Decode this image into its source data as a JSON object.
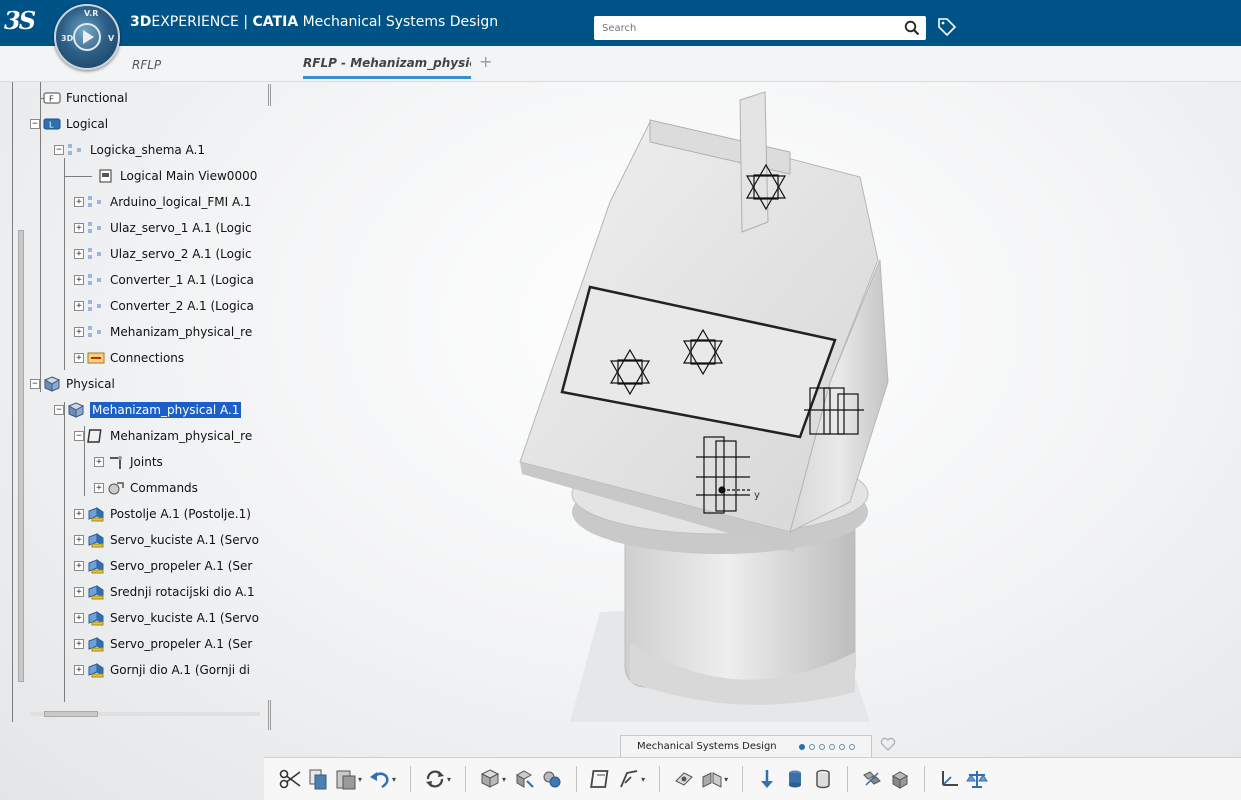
{
  "header": {
    "brand_prefix": "3D",
    "brand_experience": "EXPERIENCE",
    "separator": " | ",
    "brand_catia": "CATIA",
    "app_name": " Mechanical Systems Design",
    "compass_top": "V.R",
    "compass_left": "3D",
    "compass_right": "V",
    "search_placeholder": "Search",
    "colors": {
      "bar": "#005386",
      "selection": "#1c5fc6",
      "tab_underline": "#3a8fd0"
    }
  },
  "tabs": {
    "left_label": "RFLP",
    "active_label": "RFLP - Mehanizam_physica",
    "add_label": "+"
  },
  "tree": [
    {
      "label": "Functional",
      "icon": "functional-icon",
      "expander": ""
    },
    {
      "label": "Logical",
      "icon": "logical-icon",
      "expander": "−"
    },
    {
      "label": "Logicka_shema A.1",
      "icon": "logical-system-icon",
      "expander": "−"
    },
    {
      "label": "Logical Main View0000",
      "icon": "view-icon",
      "expander": ""
    },
    {
      "label": "Arduino_logical_FMI A.1",
      "icon": "logical-system-icon",
      "expander": "+"
    },
    {
      "label": "Ulaz_servo_1 A.1 (Logic",
      "icon": "logical-system-icon",
      "expander": "+"
    },
    {
      "label": "Ulaz_servo_2 A.1 (Logic",
      "icon": "logical-system-icon",
      "expander": "+"
    },
    {
      "label": "Converter_1 A.1 (Logica",
      "icon": "logical-system-icon",
      "expander": "+"
    },
    {
      "label": "Converter_2 A.1 (Logica",
      "icon": "logical-system-icon",
      "expander": "+"
    },
    {
      "label": "Mehanizam_physical_re",
      "icon": "logical-system-icon",
      "expander": "+"
    },
    {
      "label": "Connections",
      "icon": "connections-icon",
      "expander": "+"
    },
    {
      "label": "Physical",
      "icon": "physical-icon",
      "expander": "−"
    },
    {
      "label": "Mehanizam_physical A.1",
      "icon": "physical-product-icon",
      "expander": "−",
      "selected": true
    },
    {
      "label": "Mehanizam_physical_re",
      "icon": "mechanism-icon",
      "expander": "−"
    },
    {
      "label": "Joints",
      "icon": "joints-icon",
      "expander": "+"
    },
    {
      "label": "Commands",
      "icon": "commands-icon",
      "expander": "+"
    },
    {
      "label": "Postolje A.1 (Postolje.1)",
      "icon": "part-icon",
      "expander": "+"
    },
    {
      "label": "Servo_kuciste A.1 (Servo",
      "icon": "part-icon",
      "expander": "+"
    },
    {
      "label": "Servo_propeler A.1 (Ser",
      "icon": "part-icon",
      "expander": "+"
    },
    {
      "label": "Srednji rotacijski dio A.1",
      "icon": "part-icon",
      "expander": "+"
    },
    {
      "label": "Servo_kuciste A.1 (Servo",
      "icon": "part-icon",
      "expander": "+"
    },
    {
      "label": "Servo_propeler A.1 (Ser",
      "icon": "part-icon",
      "expander": "+"
    },
    {
      "label": "Gornji dio A.1 (Gornji di",
      "icon": "part-icon",
      "expander": "+"
    }
  ],
  "viewport": {
    "axis_label": "y"
  },
  "bottom": {
    "section_tab": "Mechanical Systems Design",
    "page_dots_total": 6,
    "page_dots_active": 1,
    "toolbar_icons": [
      "cut-icon",
      "copy-icon",
      "paste-icon",
      "undo-icon",
      "update-icon",
      "assembly-icon",
      "replace-icon",
      "product-icon",
      "mechanism-icon",
      "joint-icon",
      "snap-icon",
      "engineering-connection-icon",
      "drop-icon",
      "cylinder-icon",
      "ring-icon",
      "explode-icon",
      "kinematics-icon",
      "axis-system-icon",
      "balance-icon"
    ]
  }
}
